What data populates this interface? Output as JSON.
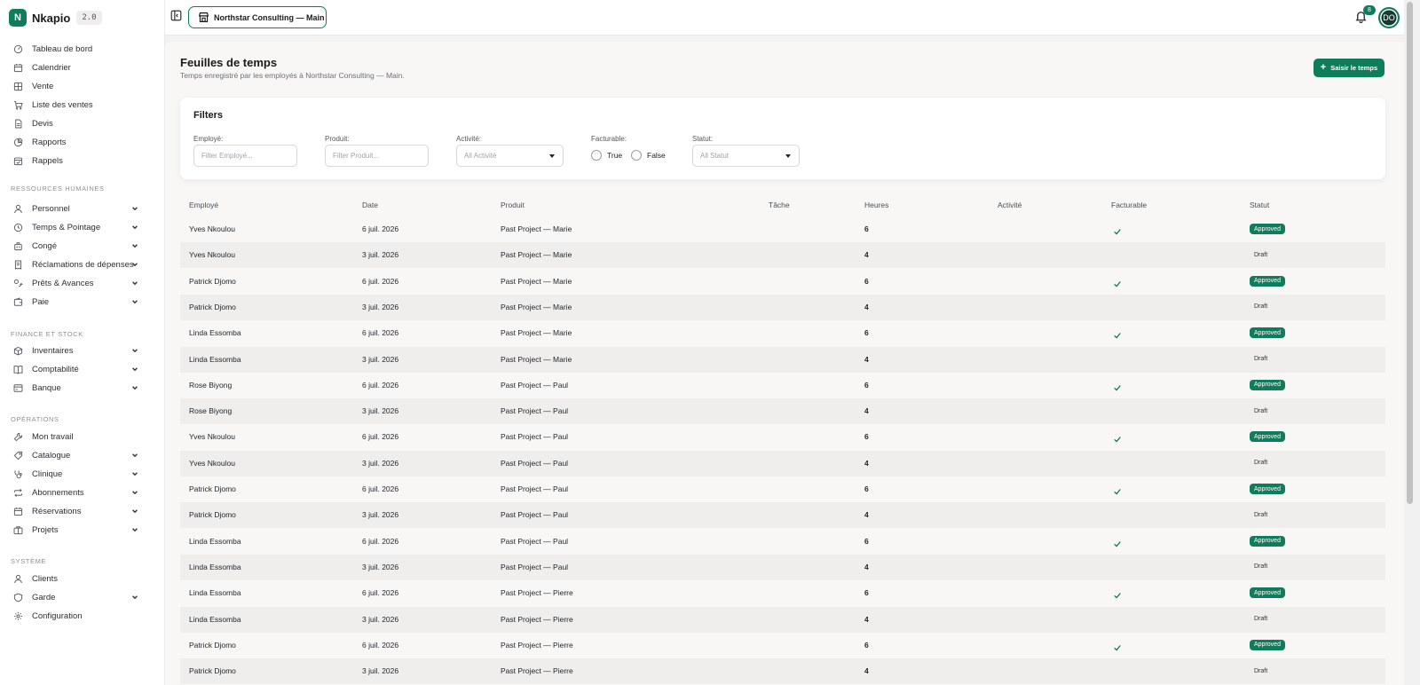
{
  "brand": {
    "name": "Nkapio",
    "version": "2.0",
    "logo_letter": "N"
  },
  "topbar": {
    "organization": "Northstar Consulting — Main",
    "notifications_count": "8",
    "avatar_initials": "DO"
  },
  "sidebar": {
    "top_items": [
      {
        "label": "Tableau de bord",
        "icon": "dashboard-icon"
      },
      {
        "label": "Calendrier",
        "icon": "calendar-icon"
      },
      {
        "label": "Vente",
        "icon": "grid-icon"
      },
      {
        "label": "Liste des ventes",
        "icon": "cart-icon"
      },
      {
        "label": "Devis",
        "icon": "document-icon"
      },
      {
        "label": "Rapports",
        "icon": "pie-chart-icon"
      },
      {
        "label": "Rappels",
        "icon": "calendar-check-icon"
      }
    ],
    "sections": [
      {
        "label": "RESSOURCES HUMAINES",
        "items": [
          {
            "label": "Personnel",
            "icon": "user-icon"
          },
          {
            "label": "Temps & Pointage",
            "icon": "clock-icon"
          },
          {
            "label": "Congé",
            "icon": "luggage-icon"
          },
          {
            "label": "Réclamations de dépenses",
            "icon": "receipt-icon"
          },
          {
            "label": "Prêts & Avances",
            "icon": "loan-icon"
          },
          {
            "label": "Paie",
            "icon": "wallet-icon"
          }
        ]
      },
      {
        "label": "FINANCE ET STOCK",
        "items": [
          {
            "label": "Inventaires",
            "icon": "box-icon"
          },
          {
            "label": "Comptabilité",
            "icon": "book-icon"
          },
          {
            "label": "Banque",
            "icon": "bank-icon"
          }
        ]
      },
      {
        "label": "OPÉRATIONS",
        "items": [
          {
            "label": "Mon travail",
            "icon": "wrench-icon"
          },
          {
            "label": "Catalogue",
            "icon": "tag-icon"
          },
          {
            "label": "Clinique",
            "icon": "stethoscope-icon"
          },
          {
            "label": "Abonnements",
            "icon": "repeat-icon"
          },
          {
            "label": "Réservations",
            "icon": "calendar-icon"
          },
          {
            "label": "Projets",
            "icon": "briefcase-icon"
          }
        ]
      },
      {
        "label": "SYSTÈME",
        "items": [
          {
            "label": "Clients",
            "icon": "user-icon"
          },
          {
            "label": "Garde",
            "icon": "shield-icon"
          },
          {
            "label": "Configuration",
            "icon": "gear-icon"
          }
        ]
      }
    ]
  },
  "page": {
    "title": "Feuilles de temps",
    "subtitle": "Temps enregistré par les employés à Northstar Consulting — Main.",
    "primary_button": "Saisir le temps"
  },
  "filters": {
    "title": "Filters",
    "employee": {
      "label": "Employé:",
      "placeholder": "Filter Employé..."
    },
    "product": {
      "label": "Produit:",
      "placeholder": "Filter Produit..."
    },
    "activity": {
      "label": "Activité:",
      "value": "All Activité"
    },
    "billable": {
      "label": "Facturable:",
      "option_true": "True",
      "option_false": "False"
    },
    "status": {
      "label": "Statut:",
      "value": "All Statut"
    }
  },
  "table": {
    "headers": [
      "Employé",
      "Date",
      "Produit",
      "Tâche",
      "Heures",
      "Activité",
      "Facturable",
      "Statut"
    ],
    "rows": [
      {
        "employee": "Yves Nkoulou",
        "date": "6 juil. 2026",
        "product": "Past Project — Marie",
        "hours": "6",
        "billable": true,
        "status": "Approved"
      },
      {
        "employee": "Yves Nkoulou",
        "date": "3 juil. 2026",
        "product": "Past Project — Marie",
        "hours": "4",
        "billable": false,
        "status": "Draft"
      },
      {
        "employee": "Patrick Djomo",
        "date": "6 juil. 2026",
        "product": "Past Project — Marie",
        "hours": "6",
        "billable": true,
        "status": "Approved"
      },
      {
        "employee": "Patrick Djomo",
        "date": "3 juil. 2026",
        "product": "Past Project — Marie",
        "hours": "4",
        "billable": false,
        "status": "Draft"
      },
      {
        "employee": "Linda Essomba",
        "date": "6 juil. 2026",
        "product": "Past Project — Marie",
        "hours": "6",
        "billable": true,
        "status": "Approved"
      },
      {
        "employee": "Linda Essomba",
        "date": "3 juil. 2026",
        "product": "Past Project — Marie",
        "hours": "4",
        "billable": false,
        "status": "Draft"
      },
      {
        "employee": "Rose Biyong",
        "date": "6 juil. 2026",
        "product": "Past Project — Paul",
        "hours": "6",
        "billable": true,
        "status": "Approved"
      },
      {
        "employee": "Rose Biyong",
        "date": "3 juil. 2026",
        "product": "Past Project — Paul",
        "hours": "4",
        "billable": false,
        "status": "Draft"
      },
      {
        "employee": "Yves Nkoulou",
        "date": "6 juil. 2026",
        "product": "Past Project — Paul",
        "hours": "6",
        "billable": true,
        "status": "Approved"
      },
      {
        "employee": "Yves Nkoulou",
        "date": "3 juil. 2026",
        "product": "Past Project — Paul",
        "hours": "4",
        "billable": false,
        "status": "Draft"
      },
      {
        "employee": "Patrick Djomo",
        "date": "6 juil. 2026",
        "product": "Past Project — Paul",
        "hours": "6",
        "billable": true,
        "status": "Approved"
      },
      {
        "employee": "Patrick Djomo",
        "date": "3 juil. 2026",
        "product": "Past Project — Paul",
        "hours": "4",
        "billable": false,
        "status": "Draft"
      },
      {
        "employee": "Linda Essomba",
        "date": "6 juil. 2026",
        "product": "Past Project — Paul",
        "hours": "6",
        "billable": true,
        "status": "Approved"
      },
      {
        "employee": "Linda Essomba",
        "date": "3 juil. 2026",
        "product": "Past Project — Paul",
        "hours": "4",
        "billable": false,
        "status": "Draft"
      },
      {
        "employee": "Linda Essomba",
        "date": "6 juil. 2026",
        "product": "Past Project — Pierre",
        "hours": "6",
        "billable": true,
        "status": "Approved"
      },
      {
        "employee": "Linda Essomba",
        "date": "3 juil. 2026",
        "product": "Past Project — Pierre",
        "hours": "4",
        "billable": false,
        "status": "Draft"
      },
      {
        "employee": "Patrick Djomo",
        "date": "6 juil. 2026",
        "product": "Past Project — Pierre",
        "hours": "6",
        "billable": true,
        "status": "Approved"
      },
      {
        "employee": "Patrick Djomo",
        "date": "3 juil. 2026",
        "product": "Past Project — Pierre",
        "hours": "4",
        "billable": false,
        "status": "Draft"
      }
    ]
  },
  "colors": {
    "accent": "#0f7d5c",
    "row_alt": "#efeeec",
    "background": "#f3f2f0"
  }
}
